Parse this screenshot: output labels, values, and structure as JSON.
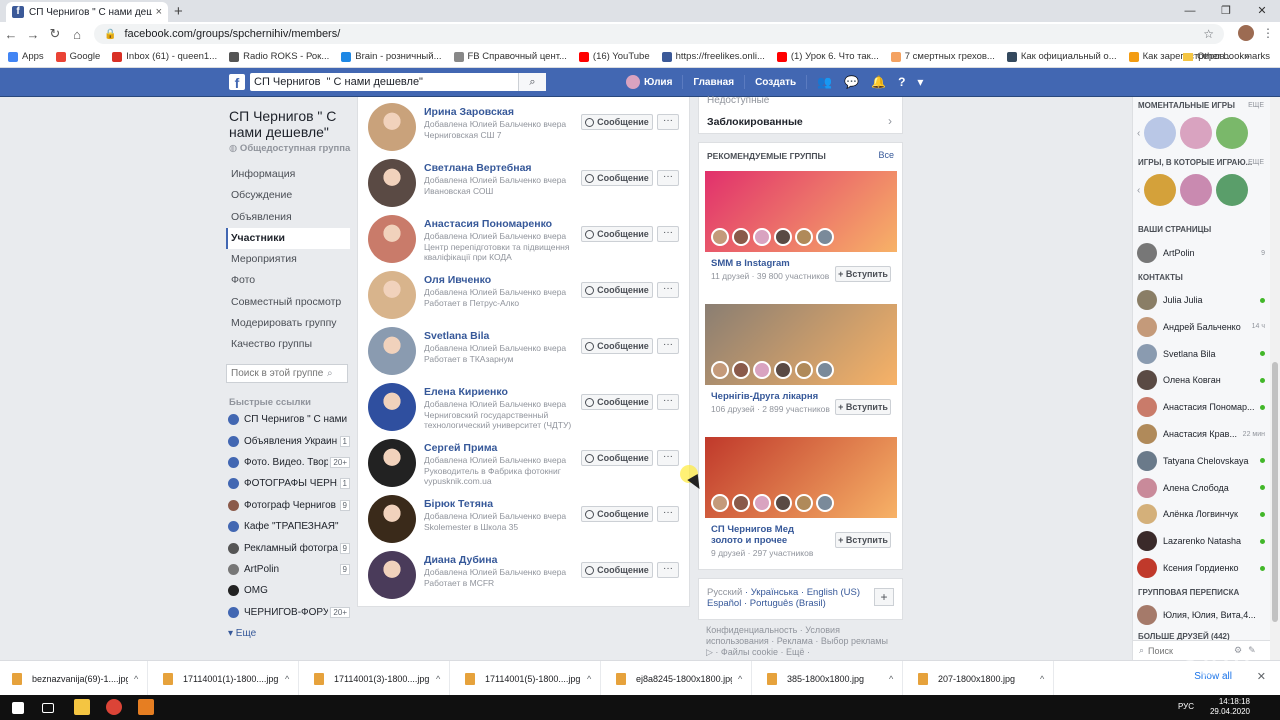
{
  "browser": {
    "tab_title": "СП Чернигов \" С нами дешевле",
    "tab_close": "×",
    "new_tab": "+",
    "url": "facebook.com/groups/spchernihiv/members/",
    "window_controls": [
      "—",
      "❐",
      "✕"
    ]
  },
  "bookmarks": [
    {
      "label": "Apps",
      "color": "#4285f4"
    },
    {
      "label": "Google",
      "color": "#ea4335"
    },
    {
      "label": "Inbox (61) - queen1...",
      "color": "#d93025"
    },
    {
      "label": "Radio ROKS - Рок...",
      "color": "#555555"
    },
    {
      "label": "Brain - розничный...",
      "color": "#1e88e5"
    },
    {
      "label": "FB Справочный цент...",
      "color": "#888888"
    },
    {
      "label": "(16) YouTube",
      "color": "#ff0000"
    },
    {
      "label": "https://freelikes.onli...",
      "color": "#3b5998"
    },
    {
      "label": "(1) Урок 6. Что так...",
      "color": "#ff0000"
    },
    {
      "label": "7 смертных грехов...",
      "color": "#f4a261"
    },
    {
      "label": "Как официальный о...",
      "color": "#34495e"
    },
    {
      "label": "Как зарегистриров...",
      "color": "#f39c12"
    }
  ],
  "bookmarks_more": "»",
  "bookmarks_other": "Other bookmarks",
  "fb": {
    "logo": "f",
    "search_value": "СП Чернигов  \" С нами дешевле\"",
    "search_icon": "⌕",
    "user_name": "Юлия",
    "home": "Главная",
    "create": "Создать"
  },
  "group": {
    "title": "СП Чернигов \" С нами дешевле\"",
    "type": "◍ Общедоступная группа",
    "nav": [
      {
        "label": "Информация",
        "active": false
      },
      {
        "label": "Обсуждение",
        "active": false
      },
      {
        "label": "Объявления",
        "active": false
      },
      {
        "label": "Участники",
        "active": true
      },
      {
        "label": "Мероприятия",
        "active": false
      },
      {
        "label": "Фото",
        "active": false
      },
      {
        "label": "Совместный просмотр",
        "active": false
      },
      {
        "label": "Модерировать группу",
        "active": false
      },
      {
        "label": "Качество группы",
        "active": false
      }
    ],
    "search_placeholder": "Поиск в этой группе",
    "quick_links_header": "Быстрые ссылки",
    "quick_links": [
      {
        "label": "СП Чернигов \" С нами ...",
        "badge": "",
        "color": "#4267b2"
      },
      {
        "label": "Объявления Украин...",
        "badge": "1",
        "color": "#4267b2"
      },
      {
        "label": "Фото. Видео. Твор...",
        "badge": "20+",
        "color": "#4267b2"
      },
      {
        "label": "ФОТОГРАФЫ ЧЕРН...",
        "badge": "1",
        "color": "#4267b2"
      },
      {
        "label": "Фотограф Чернигов ...",
        "badge": "9",
        "color": "#8b5a4a"
      },
      {
        "label": "Кафе \"ТРАПЕЗНАЯ\"",
        "badge": "",
        "color": "#4267b2"
      },
      {
        "label": "Рекламный фотогра...",
        "badge": "9",
        "color": "#555555"
      },
      {
        "label": "ArtPolin",
        "badge": "9",
        "color": "#777777"
      },
      {
        "label": "OMG",
        "badge": "",
        "color": "#222222"
      },
      {
        "label": "ЧЕРНИГОВ-ФОРУМ",
        "badge": "20+",
        "color": "#4267b2"
      }
    ],
    "quick_links_more": "▾ Еще"
  },
  "members": {
    "message_label": "Сообщение",
    "more_label": "···",
    "items": [
      {
        "name": "Ирина Заровская",
        "line1": "Добавлена Юлией Бальченко вчера",
        "line2": "Черниговская СШ 7",
        "color": "#c9a27b"
      },
      {
        "name": "Светлана Вертебная",
        "line1": "Добавлена Юлией Бальченко вчера",
        "line2": "Ивановская СОШ",
        "color": "#5a4a44"
      },
      {
        "name": "Анастасия Пономаренко",
        "line1": "Добавлена Юлией Бальченко вчера",
        "line2": "Центр перепідготовки та підвищення кваліфікації при КОДА",
        "color": "#c97b6a"
      },
      {
        "name": "Оля Ивченко",
        "line1": "Добавлена Юлией Бальченко вчера",
        "line2": "Работает в Петрус-Алко",
        "color": "#d8b48c"
      },
      {
        "name": "Svetlana Bila",
        "line1": "Добавлена Юлией Бальченко вчера",
        "line2": "Работает в ТКАзарнум",
        "color": "#8a9bb0"
      },
      {
        "name": "Елена Кириенко",
        "line1": "Добавлена Юлией Бальченко вчера",
        "line2": "Черниговский государственный технологический университет (ЧДТУ)",
        "color": "#2f4f9f"
      },
      {
        "name": "Сергей Прима",
        "line1": "Добавлена Юлией Бальченко вчера",
        "line2": "Руководитель в Фабрика фотокниг vypusknik.com.ua",
        "color": "#222222"
      },
      {
        "name": "Бірюк Тетяна",
        "line1": "Добавлена Юлией Бальченко вчера",
        "line2": "Skolemester в Школа 35",
        "color": "#3a2a1a"
      },
      {
        "name": "Диана Дубина",
        "line1": "Добавлена Юлией Бальченко вчера",
        "line2": "Работает в MCFR",
        "color": "#4a3b5a"
      }
    ]
  },
  "right": {
    "top_cut": "Недоступные",
    "blocked": "Заблокированные",
    "rec_header": "РЕКОМЕНДУЕМЫЕ ГРУППЫ",
    "rec_all": "Все",
    "join_label": "+ Вступить",
    "groups": [
      {
        "name": "SMM в Instagram",
        "meta": "11 друзей · 39 800 участников",
        "img_color": "#e1306c"
      },
      {
        "name": "Чернігів-Друга лікарня",
        "meta": "106 друзей · 2 899 участников",
        "img_color": "#8a7e72"
      },
      {
        "name": "СП Чернигов Мед золото и прочее",
        "meta": "9 друзей · 297 участников",
        "img_color": "#c0392b"
      }
    ],
    "languages_current": "Русский",
    "languages": "Українська · English (US) Español · Português (Brasil)",
    "lang_plus": "+",
    "footer": "Конфиденциальность · Условия использования · Реклама · Выбор рекламы ▷ · Файлы cookie · Ещё ·"
  },
  "chat": {
    "instant_games": "МОМЕНТАЛЬНЫЕ ИГРЫ",
    "games_played": "ИГРЫ, В КОТОРЫЕ ИГРАЮ...",
    "more": "ЕЩЕ",
    "your_pages": "ВАШИ СТРАНИЦЫ",
    "page_name": "ArtPolin",
    "page_badge": "9",
    "contacts_header": "КОНТАКТЫ",
    "contacts": [
      {
        "name": "Julia Julia",
        "time": "",
        "online": true,
        "color": "#8a7e66"
      },
      {
        "name": "Андрей Бальченко",
        "time": "14 ч",
        "online": false,
        "color": "#c49a7a"
      },
      {
        "name": "Svetlana Bila",
        "time": "",
        "online": true,
        "color": "#8a9bb0"
      },
      {
        "name": "Олена Ковган",
        "time": "",
        "online": true,
        "color": "#5a4a44"
      },
      {
        "name": "Анастасия Пономар...",
        "time": "",
        "online": true,
        "color": "#c97b6a"
      },
      {
        "name": "Анастасия Крав...",
        "time": "22 мин",
        "online": false,
        "color": "#b08a5a"
      },
      {
        "name": "Tatyana Chelovskaya",
        "time": "",
        "online": true,
        "color": "#6a7a8a"
      },
      {
        "name": "Алена Слобода",
        "time": "",
        "online": true,
        "color": "#c98a9a"
      },
      {
        "name": "Алёнка Логвинчук",
        "time": "",
        "online": true,
        "color": "#d4b07a"
      },
      {
        "name": "Lazarenko Natasha",
        "time": "",
        "online": true,
        "color": "#3a2a2a"
      },
      {
        "name": "Ксения Гордиенко",
        "time": "",
        "online": true,
        "color": "#c0392b"
      }
    ],
    "group_chats": "ГРУППОВАЯ ПЕРЕПИСКА",
    "group_chat_name": "Юлия, Юлия, Вита,4...",
    "more_friends": "БОЛЬШЕ ДРУЗЕЙ (442)",
    "search_placeholder": "Поиск"
  },
  "downloads": {
    "items": [
      "beznazvanija(69)-1....jpg",
      "17114001(1)-1800....jpg",
      "17114001(3)-1800....jpg",
      "17114001(5)-1800....jpg",
      "ej8a8245-1800x1800.jpg",
      "385-1800x1800.jpg",
      "207-1800x1800.jpg"
    ],
    "show_all": "Show all",
    "close": "✕"
  },
  "taskbar": {
    "lang": "РУС",
    "time": "14:18:18",
    "date": "29.04.2020"
  }
}
